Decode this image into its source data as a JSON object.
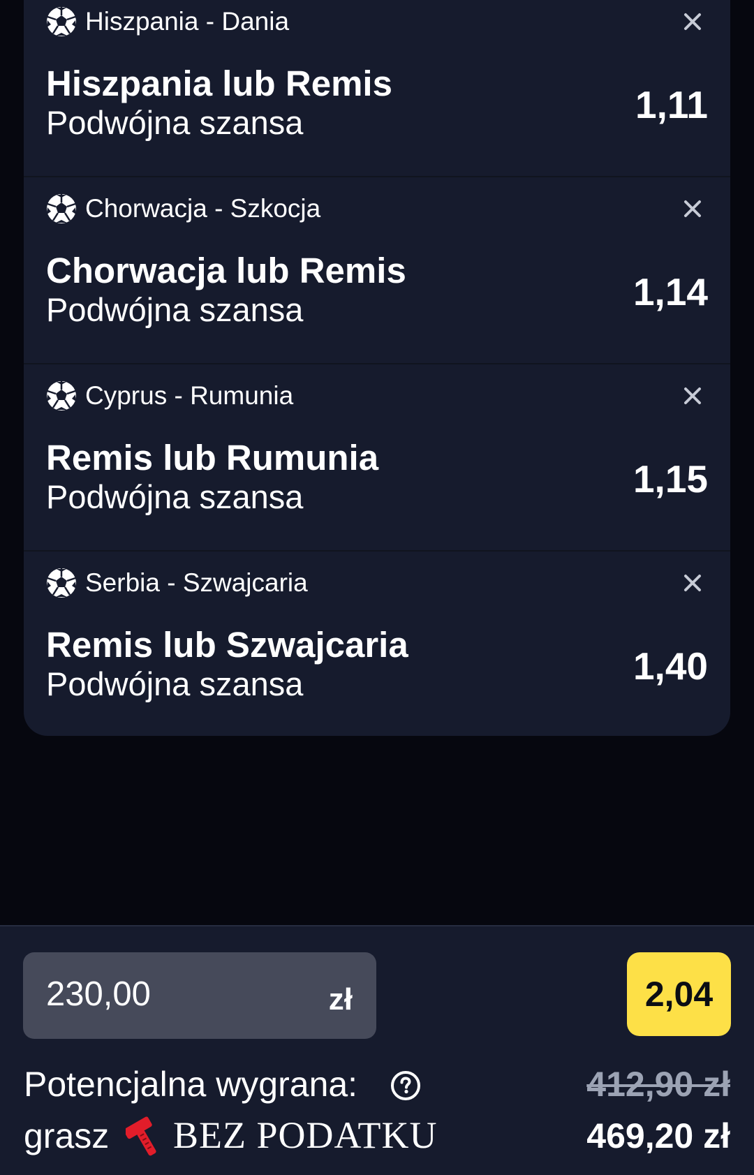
{
  "bets": [
    {
      "match": "Hiszpania - Dania",
      "selection": "Hiszpania lub Remis",
      "market": "Podwójna szansa",
      "odds": "1,11"
    },
    {
      "match": "Chorwacja - Szkocja",
      "selection": "Chorwacja lub Remis",
      "market": "Podwójna szansa",
      "odds": "1,14"
    },
    {
      "match": "Cyprus - Rumunia",
      "selection": "Remis lub Rumunia",
      "market": "Podwójna szansa",
      "odds": "1,15"
    },
    {
      "match": "Serbia - Szwajcaria",
      "selection": "Remis lub Szwajcaria",
      "market": "Podwójna szansa",
      "odds": "1,40"
    }
  ],
  "stake": {
    "value": "230,00",
    "currency": "zł"
  },
  "total_odds": "2,04",
  "summary": {
    "potential_label": "Potencjalna wygrana:",
    "old_win": "412,90 zł",
    "grasz_label": "grasz",
    "tax_text": "BEZ PODATKU",
    "final_win": "469,20 zł"
  },
  "icons": {
    "sport": "soccer-ball-icon",
    "remove": "close-icon",
    "help": "question-circle-icon",
    "brand": "hammer-icon"
  },
  "colors": {
    "background": "#06070f",
    "card": "#161b2d",
    "accent": "#fde047",
    "input": "#464a5a",
    "brand": "#e11d2a"
  }
}
